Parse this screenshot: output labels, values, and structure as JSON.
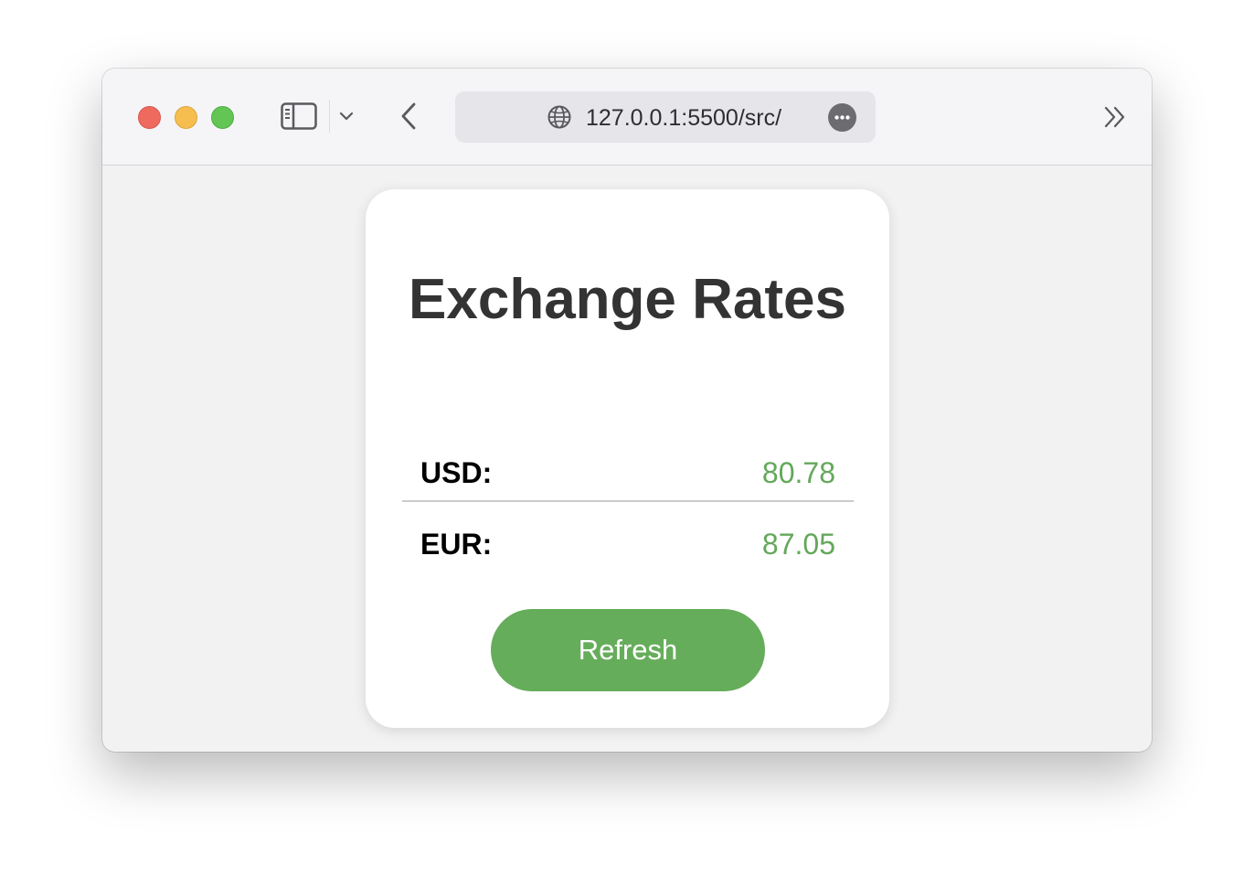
{
  "browser": {
    "url": "127.0.0.1:5500/src/",
    "icons": {
      "sidebar": "sidebar-toggle-icon",
      "tab_menu": "chevron-down-icon",
      "back": "chevron-left-icon",
      "site": "globe-icon",
      "page_menu": "ellipsis-icon",
      "overflow": "double-chevron-right-icon"
    }
  },
  "card": {
    "title": "Exchange Rates",
    "rates": [
      {
        "label": "USD:",
        "value": "80.78"
      },
      {
        "label": "EUR:",
        "value": "87.05"
      }
    ],
    "refresh_label": "Refresh"
  },
  "colors": {
    "accent_green": "#66ad5b",
    "value_green": "#63a85a",
    "title_text": "#333333"
  }
}
